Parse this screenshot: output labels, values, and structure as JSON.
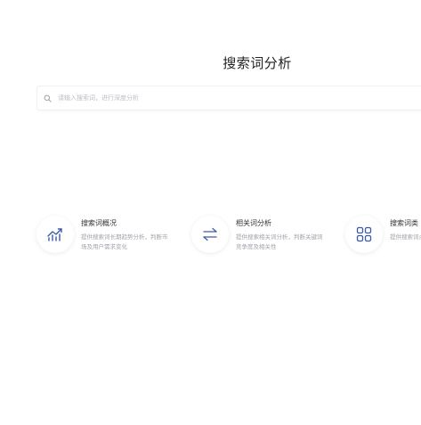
{
  "header": {
    "title": "搜索词分析"
  },
  "search": {
    "placeholder": "请输入搜索词，进行深度分析"
  },
  "features": [
    {
      "icon": "trend-chart-icon",
      "title": "搜索词概况",
      "description": "提供搜索词长期趋势分析，判断市场及用户需求变化"
    },
    {
      "icon": "swap-arrows-icon",
      "title": "相关词分析",
      "description": "提供搜索相关词分析，判断关键词竞争度及相关性"
    },
    {
      "icon": "grid-icon",
      "title": "搜索词类",
      "description": "提供搜索词点击及点击"
    }
  ],
  "colors": {
    "accent": "#3a5ca8",
    "title_text": "#222222",
    "muted_text": "#a0a4ad",
    "border": "#eef0f4"
  }
}
